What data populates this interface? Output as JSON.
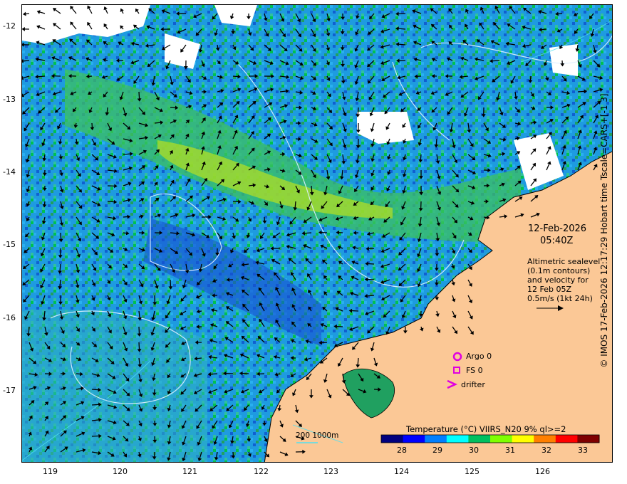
{
  "date": "12-Feb-2026",
  "time": "05:40Z",
  "altimetry_note": [
    "Altimetric sealevel",
    "(0.1m contours)",
    "and velocity for",
    "12 Feb 05Z",
    "0.5m/s (1kt 24h)"
  ],
  "side_credit": "© IMOS 17-Feb-2026 12:17:29 Hobart time Tscale=CARS+[-1 3]",
  "x_ticks": [
    "119",
    "120",
    "121",
    "122",
    "123",
    "124",
    "125",
    "126"
  ],
  "y_ticks": [
    "-12",
    "-13",
    "-14",
    "-15",
    "-16",
    "-17"
  ],
  "legend": {
    "argo": "Argo 0",
    "fs": "FS 0",
    "drifter": "drifter",
    "argo_color": "#e000e0"
  },
  "colorbar": {
    "title": "Temperature (°C) VIIRS_N20 9% ql>=2",
    "ticks": [
      "28",
      "29",
      "30",
      "31",
      "32",
      "33"
    ],
    "colors": [
      "#00007f",
      "#0000ff",
      "#007fff",
      "#00ffff",
      "#00c060",
      "#7fff00",
      "#ffff00",
      "#ff7f00",
      "#ff0000",
      "#7f0000"
    ]
  },
  "depth_scale": "200  1000m",
  "land_color": "#fbc896",
  "cloud_color": "#ffffff"
}
